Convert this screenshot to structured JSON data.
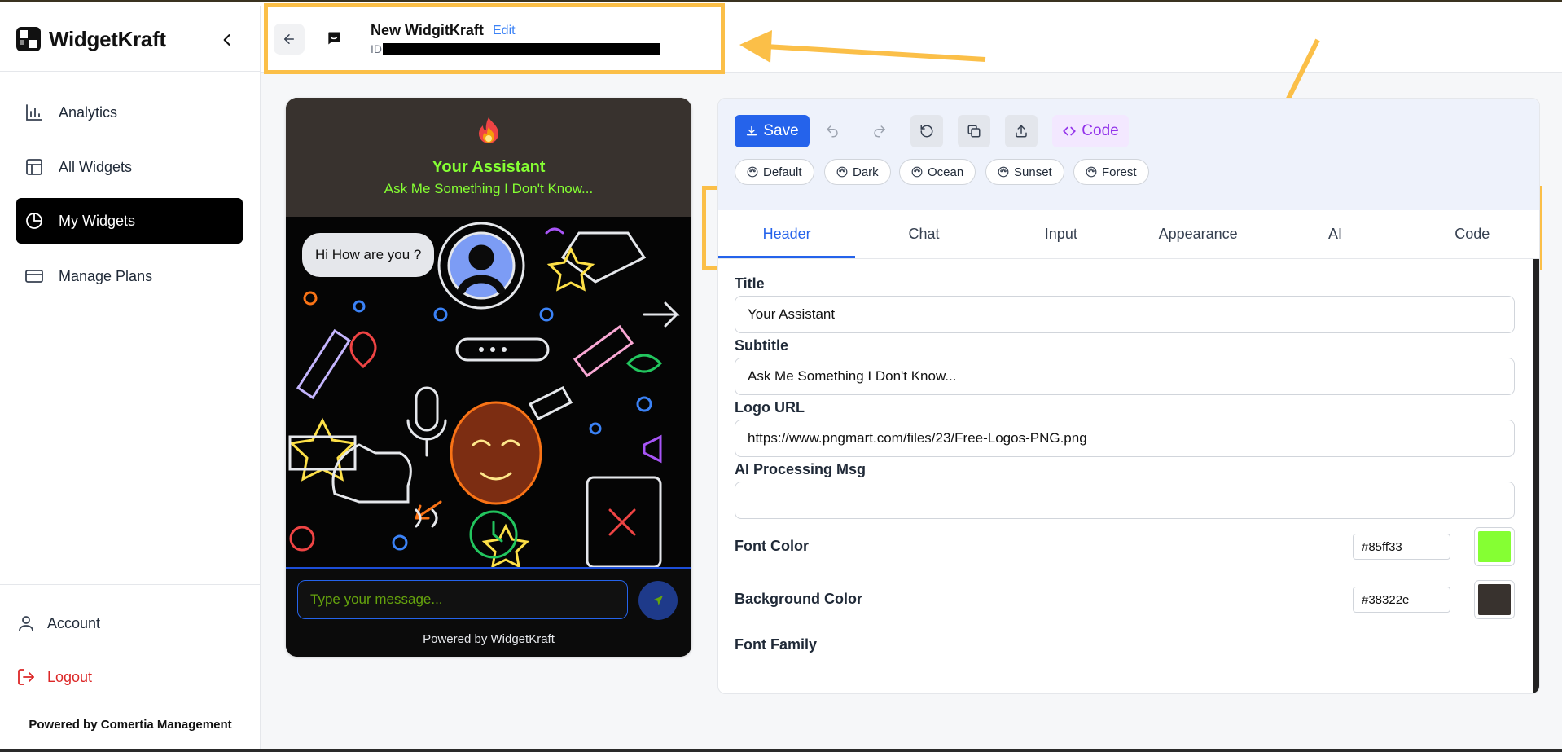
{
  "app": {
    "name": "WidgetKraft"
  },
  "sidebar": {
    "items": [
      {
        "label": "Analytics",
        "icon": "bar-chart-icon",
        "active": false
      },
      {
        "label": "All Widgets",
        "icon": "layout-icon",
        "active": false
      },
      {
        "label": "My Widgets",
        "icon": "pie-chart-icon",
        "active": true
      },
      {
        "label": "Manage Plans",
        "icon": "credit-card-icon",
        "active": false
      }
    ],
    "account_label": "Account",
    "logout_label": "Logout",
    "footer": "Powered by Comertia Management"
  },
  "header": {
    "widget_name": "New WidgitKraft",
    "edit_label": "Edit",
    "id_label": "ID"
  },
  "preview": {
    "title": "Your Assistant",
    "subtitle": "Ask Me Something I Don't Know...",
    "bubble": "Hi How are you ?",
    "input_placeholder": "Type your message...",
    "powered_by": "Powered by WidgetKraft"
  },
  "toolbar": {
    "save_label": "Save",
    "code_label": "Code",
    "themes": [
      "Default",
      "Dark",
      "Ocean",
      "Sunset",
      "Forest"
    ]
  },
  "tabs": [
    "Header",
    "Chat",
    "Input",
    "Appearance",
    "AI",
    "Code"
  ],
  "active_tab": "Header",
  "form": {
    "title_label": "Title",
    "title_value": "Your Assistant",
    "subtitle_label": "Subtitle",
    "subtitle_value": "Ask Me Something I Don't Know...",
    "logo_label": "Logo URL",
    "logo_value": "https://www.pngmart.com/files/23/Free-Logos-PNG.png",
    "ai_msg_label": "AI Processing Msg",
    "ai_msg_value": "",
    "font_color_label": "Font Color",
    "font_color_value": "#85ff33",
    "bg_color_label": "Background Color",
    "bg_color_value": "#38322e",
    "font_family_label": "Font Family"
  },
  "colors": {
    "accent": "#2563eb",
    "highlight": "#fbbf48",
    "font_color": "#85ff33",
    "header_bg": "#38322e"
  }
}
